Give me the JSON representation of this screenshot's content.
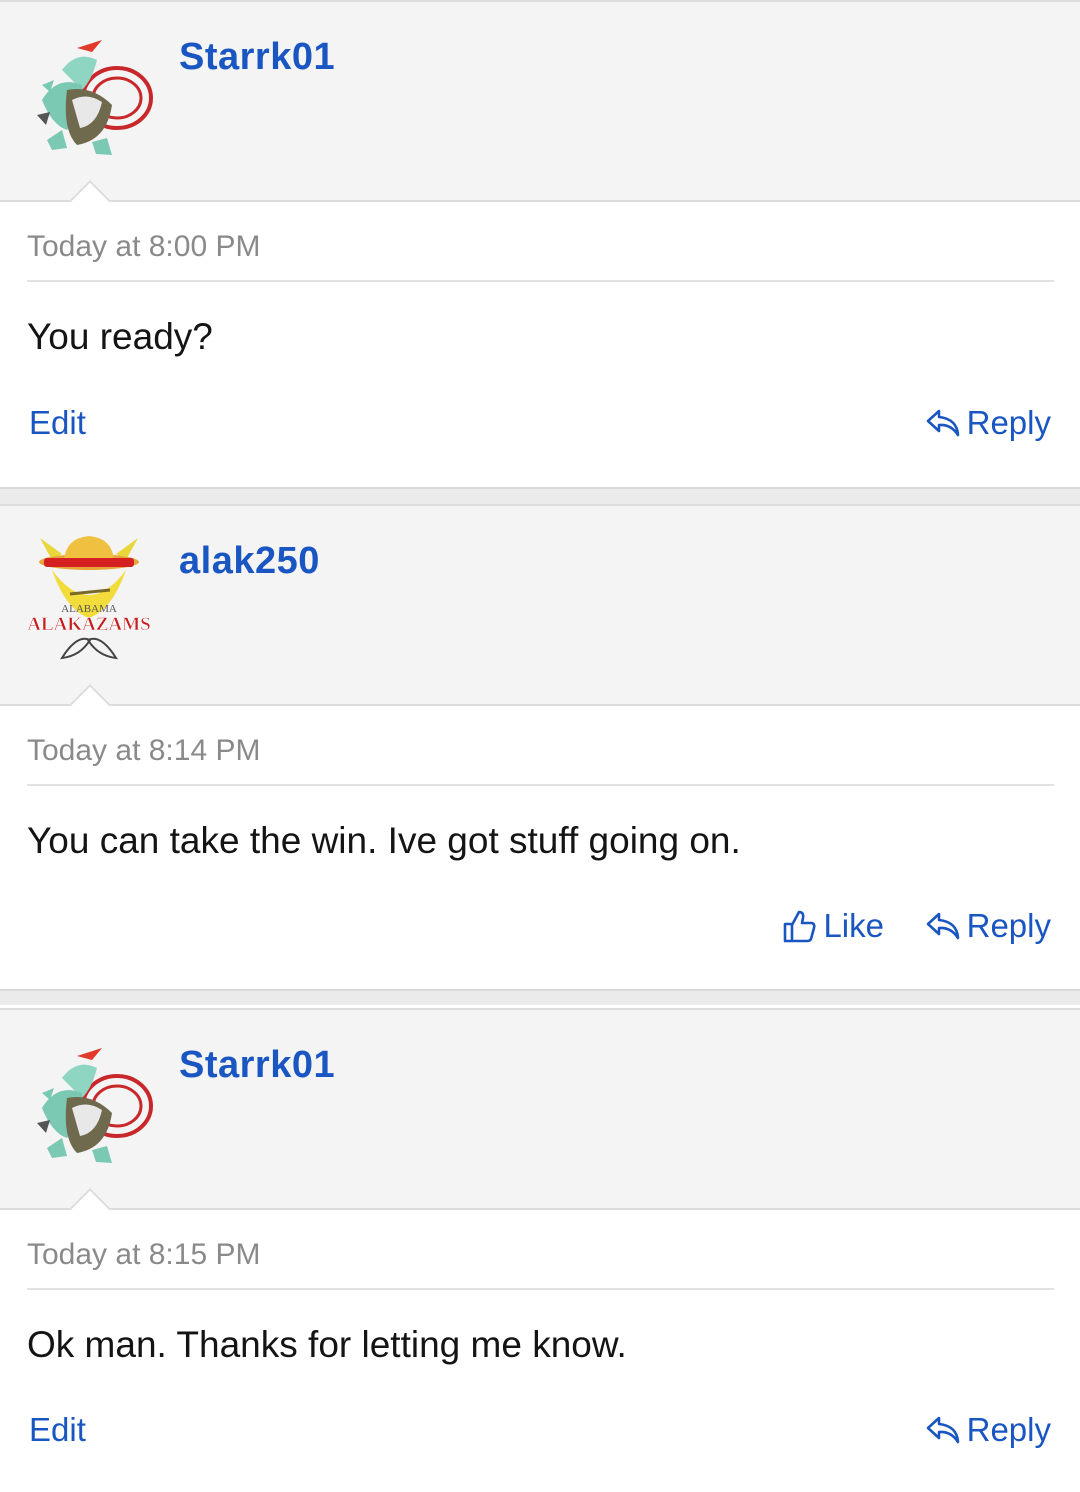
{
  "posts": [
    {
      "username": "Starrk01",
      "avatar_icon": "pokemon-dragon-avatar-icon",
      "time": "Today at 8:00 PM",
      "message": "You ready?",
      "left_action": "Edit",
      "reply_label": "Reply"
    },
    {
      "username": "alak250",
      "avatar_icon": "alakazams-team-logo-icon",
      "avatar_logo_text": "ALAKAZAMS",
      "avatar_logo_subtext": "ALABAMA",
      "time": "Today at 8:14 PM",
      "message": "You can take the win. Ive got stuff going on.",
      "like_label": "Like",
      "reply_label": "Reply"
    },
    {
      "username": "Starrk01",
      "avatar_icon": "pokemon-dragon-avatar-icon",
      "time": "Today at 8:15 PM",
      "message": "Ok man. Thanks for letting me know.",
      "left_action": "Edit",
      "reply_label": "Reply"
    }
  ],
  "colors": {
    "link": "#1a56c2",
    "header_bg": "#f4f4f4",
    "timestamp": "#8a8a8a",
    "text": "#141414"
  }
}
